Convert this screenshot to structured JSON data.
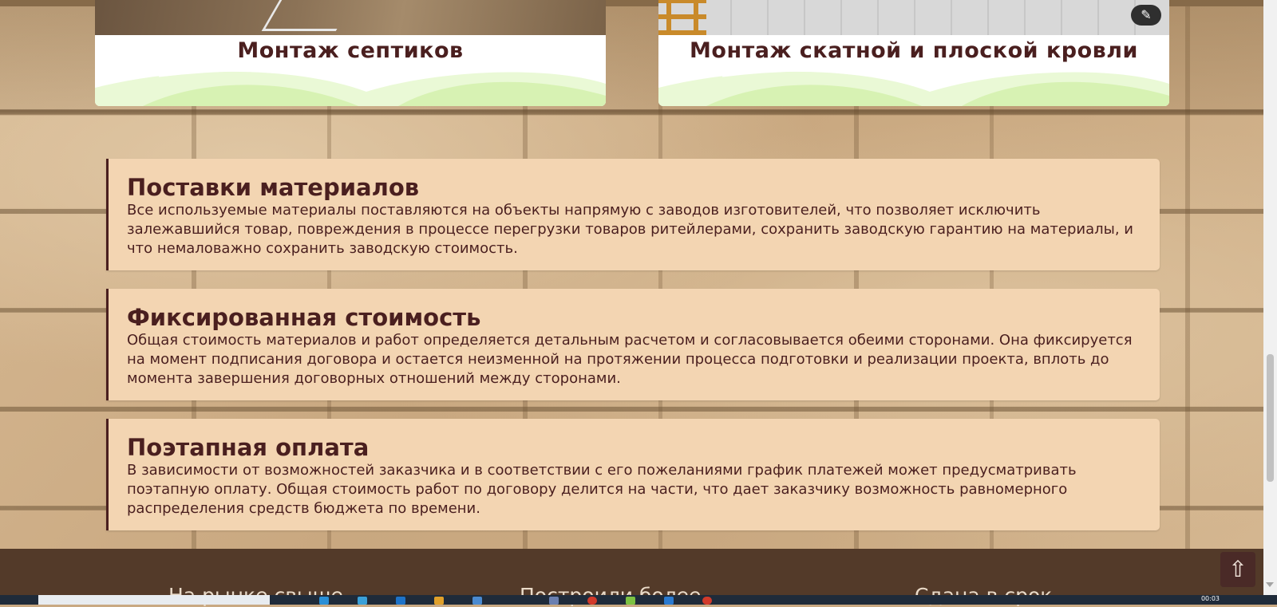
{
  "services": [
    {
      "title": "Монтаж септиков"
    },
    {
      "title": "Монтаж скатной и плоской кровли",
      "action_icon": "magic-wand-icon"
    }
  ],
  "features": [
    {
      "title": "Поставки материалов",
      "text": "Все используемые материалы поставляются на объекты напрямую с заводов изготовителей, что позволяет исключить залежавшийся товар, повреждения в процессе перегрузки товаров ритейлерами, сохранить заводскую гарантию на материалы, и что немаловажно сохранить заводскую стоимость."
    },
    {
      "title": "Фиксированная стоимость",
      "text": "Общая стоимость материалов и работ определяется детальным расчетом и согласовывается обеими сторонами. Она фиксируется на момент подписания договора и остается неизменной на протяжении процесса подготовки и реализации проекта, вплоть до момента завершения договорных отношений между сторонами."
    },
    {
      "title": "Поэтапная оплата",
      "text": "В зависимости от возможностей заказчика и в соответствии с его пожеланиями график платежей может предусматривать поэтапную оплату. Общая стоимость работ по договору делится на части, что дает заказчику возможность равномерного распределения средств бюджета по времени."
    }
  ],
  "footer": {
    "stats": [
      "На рынке свыше",
      "Построили более",
      "Сдана в срок"
    ],
    "scroll_top_glyph": "⇧"
  },
  "taskbar": {
    "time": "00:03"
  },
  "colors": {
    "accent": "#4a1f1f",
    "box": "#f3d5b2",
    "footer": "#533a29"
  }
}
